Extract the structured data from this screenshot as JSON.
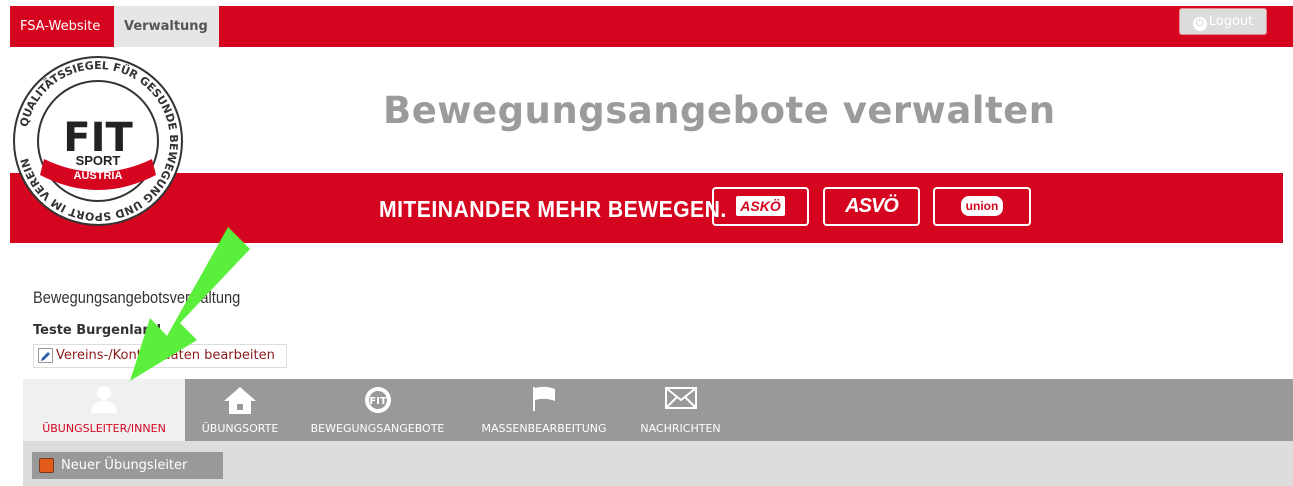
{
  "topnav": {
    "site_label": "FSA-Website",
    "admin_label": "Verwaltung",
    "logout_label": "Logout"
  },
  "banner": {
    "headline": "Bewegungsangebote verwalten",
    "slogan": "MITEINANDER MEHR BEWEGEN.",
    "partners": [
      "ASKÖ",
      "ASVÖ",
      "union"
    ],
    "logo": {
      "ring_text": "QUALITÄTSSIEGEL FÜR GESUNDE BEWEGUNG UND SPORT IM VEREIN",
      "main": "FIT",
      "sport": "SPORT",
      "austria": "AUSTRIA"
    }
  },
  "page": {
    "section_title": "Bewegungsangebotsverwaltung",
    "club_name": "Teste Burgenland",
    "edit_link": "Vereins-/Kontaktdaten bearbeiten"
  },
  "tabs": [
    {
      "label": "ÜBUNGSLEITER/INNEN",
      "icon": "person-icon",
      "active": true
    },
    {
      "label": "ÜBUNGSORTE",
      "icon": "home-icon",
      "active": false
    },
    {
      "label": "BEWEGUNGSANGEBOTE",
      "icon": "fit-logo-icon",
      "active": false
    },
    {
      "label": "MASSENBEARBEITUNG",
      "icon": "flag-icon",
      "active": false
    },
    {
      "label": "NACHRICHTEN",
      "icon": "envelope-icon",
      "active": false
    }
  ],
  "toolbar": {
    "new_button": "Neuer Übungsleiter"
  },
  "colors": {
    "brand_red": "#d6051f",
    "tab_gray": "#999999",
    "annotation_green": "#5aef3a"
  }
}
